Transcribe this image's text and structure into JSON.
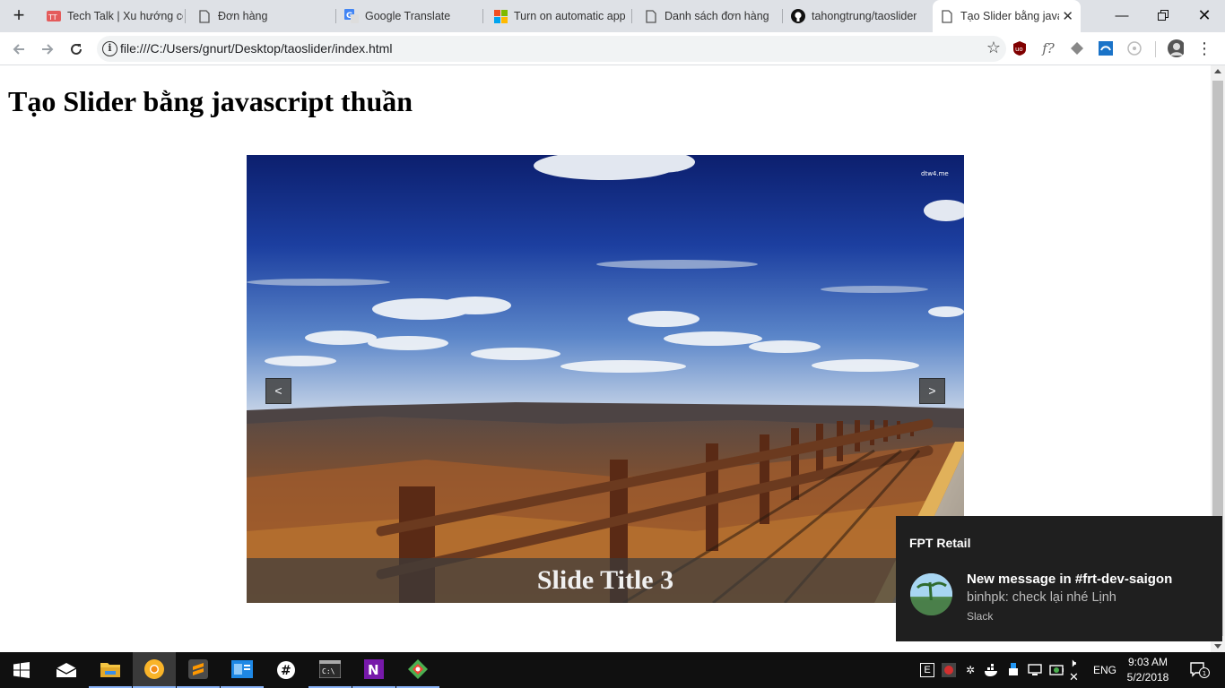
{
  "tabs": [
    {
      "title": "Tech Talk | Xu hướng công",
      "icon": "techtalk-icon"
    },
    {
      "title": "Đơn hàng",
      "icon": "page-icon"
    },
    {
      "title": "Google Translate",
      "icon": "google-translate-icon"
    },
    {
      "title": "Turn on automatic app",
      "icon": "microsoft-icon"
    },
    {
      "title": "Danh sách đơn hàng",
      "icon": "page-icon"
    },
    {
      "title": "tahongtrung/taoslider",
      "icon": "github-icon"
    },
    {
      "title": "Tạo Slider bằng javascript thuần",
      "icon": "page-icon",
      "active": true
    }
  ],
  "address_bar": {
    "url": "file:///C:/Users/gnurt/Desktop/taoslider/index.html"
  },
  "page": {
    "heading": "Tạo Slider bằng javascript thuần",
    "slider": {
      "prev_label": "<",
      "next_label": ">",
      "caption": "Slide Title 3",
      "watermark": "dtw4.me"
    }
  },
  "notification": {
    "app": "FPT Retail",
    "title": "New message in #frt-dev-saigon",
    "message": "binhpk: check lại nhé Lịnh",
    "source": "Slack"
  },
  "taskbar": {
    "language": "ENG",
    "time": "9:03 AM",
    "date": "5/2/2018",
    "notification_count": "1"
  },
  "colors": {
    "accent": "#8ab4f8",
    "tab_bar": "#dee1e6",
    "taskbar": "#101010"
  }
}
